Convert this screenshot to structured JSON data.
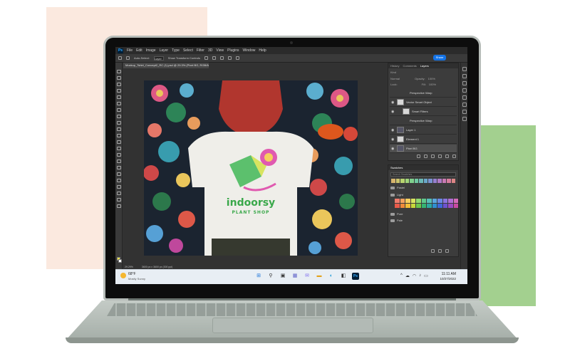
{
  "photoshop": {
    "logo": "Ps",
    "menu": [
      "File",
      "Edit",
      "Image",
      "Layer",
      "Type",
      "Select",
      "Filter",
      "3D",
      "View",
      "Plugins",
      "Window",
      "Help"
    ],
    "options": {
      "auto_select": "Auto-Select:",
      "auto_select_value": "Layer",
      "transform": "Show Transform Controls"
    },
    "share_label": "Share",
    "document_tab": "Mockup_Tshirt_Concept2_RC (1).psd @ 29.3% (Pixel BG, RGB/8#) *",
    "status_zoom": "29.29%",
    "status_size": "3600 px x 3600 px (300 ppi)"
  },
  "artwork": {
    "brand_name": "indoorsy",
    "brand_tagline": "PLANT SHOP",
    "colors": {
      "logo_green": "#3aa84a",
      "logo_pink": "#e05ab0",
      "shirt": "#efeee9",
      "hair": "#b1362e",
      "bg_dark": "#1b2430"
    }
  },
  "layers_panel": {
    "tabs": [
      "History",
      "Comments",
      "Layers"
    ],
    "active_tab": "Layers",
    "kind_label": "Kind",
    "blend_mode": "Normal",
    "opacity_label": "Opacity:",
    "opacity_value": "100%",
    "lock_label": "Lock:",
    "fill_label": "Fill:",
    "fill_value": "100%",
    "layers": [
      {
        "name": "Perspective Warp"
      },
      {
        "name": "Vector Smart Object"
      },
      {
        "name": "Smart Filters"
      },
      {
        "name": "Perspective Warp"
      },
      {
        "name": "Layer 1"
      },
      {
        "name": "Element 1"
      },
      {
        "name": "Pixel BG"
      }
    ]
  },
  "swatches_panel": {
    "title": "Swatches",
    "search_placeholder": "Search Swatches",
    "folders": [
      "Pastel",
      "Light",
      "Pure",
      "Pale"
    ],
    "top_row_colors": [
      "#d7b56d",
      "#c9c46d",
      "#b8d46f",
      "#9fd47a",
      "#7fd08d",
      "#6fc7a0",
      "#6cb9b6",
      "#6aa6c9",
      "#7a93d2",
      "#967fcf",
      "#b07ac6",
      "#c97ab3",
      "#d67c9c",
      "#dc8585"
    ],
    "light_colors_1": [
      "#f07c6c",
      "#f3a35f",
      "#f6cf5e",
      "#d8e45f",
      "#8fd86f",
      "#5ec98c",
      "#57bfb9",
      "#5aa7de",
      "#6b87e5",
      "#8a74de",
      "#b06ed4",
      "#d56bb8"
    ],
    "light_colors_2": [
      "#e85b4a",
      "#ee8a3a",
      "#f2bd37",
      "#c7d83a",
      "#6cc64d",
      "#35b472",
      "#2ea8a2",
      "#2f8fd0",
      "#4068d8",
      "#6d52cf",
      "#9a4cc2",
      "#c84aa2"
    ]
  },
  "taskbar": {
    "weather_temp": "68°F",
    "weather_desc": "Mostly Sunny",
    "start_icon": "⊞",
    "icons": [
      "search-icon",
      "task-view-icon",
      "widgets-icon",
      "chat-icon",
      "explorer-icon",
      "edge-icon",
      "store-icon",
      "photoshop-icon"
    ],
    "clock_time": "11:11 AM",
    "clock_date": "10/27/2022"
  }
}
